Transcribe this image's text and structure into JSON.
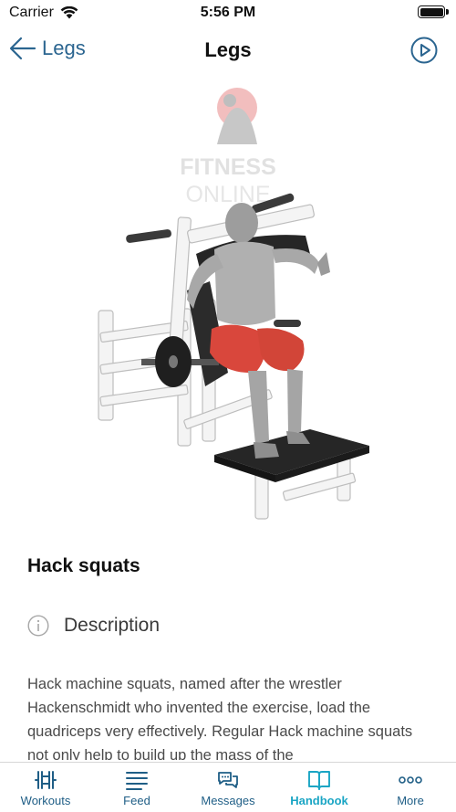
{
  "status_bar": {
    "carrier": "Carrier",
    "time": "5:56 PM"
  },
  "nav": {
    "back_label": "Legs",
    "title": "Legs"
  },
  "illustration": {
    "watermark_line1": "FITNESS",
    "watermark_line2": "ONLINE"
  },
  "exercise": {
    "title": "Hack squats",
    "description_heading": "Description",
    "description_text": "Hack machine squats, named after the wrestler Hackenschmidt who invented the exercise, load the quadriceps very effectively. Regular Hack machine squats not only help to build up the mass of the"
  },
  "tabbar": {
    "tabs": [
      {
        "label": "Workouts",
        "icon": "dumbbell-icon"
      },
      {
        "label": "Feed",
        "icon": "feed-lines-icon"
      },
      {
        "label": "Messages",
        "icon": "chat-bubbles-icon"
      },
      {
        "label": "Handbook",
        "icon": "book-icon",
        "active": true
      },
      {
        "label": "More",
        "icon": "more-dots-icon"
      }
    ]
  },
  "colors": {
    "accent": "#2b6590",
    "active_tab": "#1aa5c4",
    "muscle": "#d9473c"
  }
}
